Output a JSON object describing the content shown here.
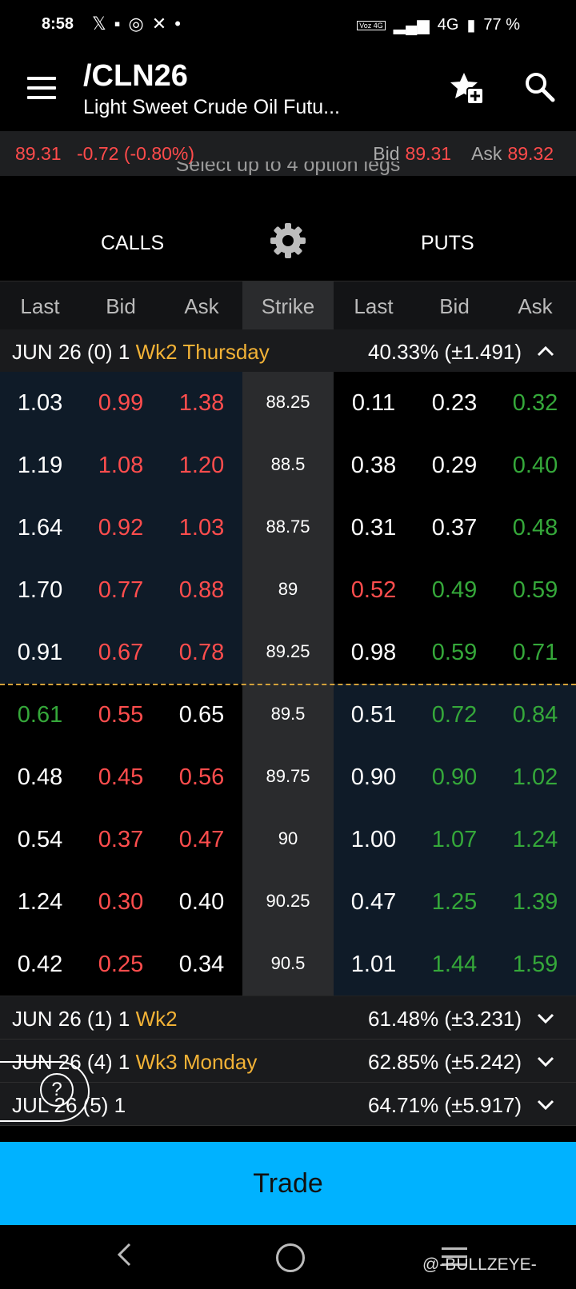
{
  "status_bar": {
    "time": "8:58",
    "left_icons": [
      "x-icon",
      "video-icon",
      "meta-icon",
      "crossed-icon",
      "dot-icon"
    ],
    "voz_label": "Voz 4G",
    "network": "4G",
    "battery": "77 %"
  },
  "header": {
    "symbol": "/CLN26",
    "description": "Light Sweet Crude Oil Futu..."
  },
  "quote": {
    "last": "89.31",
    "change": "-0.72 (-0.80%)",
    "bid_label": "Bid",
    "bid": "89.31",
    "ask_label": "Ask",
    "ask": "89.32"
  },
  "hint": "Select up to 4 option legs",
  "tabs": {
    "calls": "CALLS",
    "puts": "PUTS"
  },
  "columns": [
    "Last",
    "Bid",
    "Ask",
    "Strike",
    "Last",
    "Bid",
    "Ask"
  ],
  "groups": [
    {
      "label": "JUN 26 (0) 1",
      "week": "Wk2 Thursday",
      "iv": "40.33% (±1.491)",
      "expanded": true
    },
    {
      "label": "JUN 26 (1) 1",
      "week": "Wk2",
      "iv": "61.48% (±3.231)",
      "expanded": false
    },
    {
      "label": "JUN 26 (4) 1",
      "week": "Wk3 Monday",
      "iv": "62.85% (±5.242)",
      "expanded": false
    },
    {
      "label": "JUL 26 (5) 1",
      "week": "",
      "iv": "64.71% (±5.917)",
      "expanded": false
    }
  ],
  "rows": [
    {
      "call": [
        "1.03",
        "0.99",
        "1.38"
      ],
      "strike": "88.25",
      "put": [
        "0.11",
        "0.23",
        "0.32"
      ]
    },
    {
      "call": [
        "1.19",
        "1.08",
        "1.20"
      ],
      "strike": "88.5",
      "put": [
        "0.38",
        "0.29",
        "0.40"
      ]
    },
    {
      "call": [
        "1.64",
        "0.92",
        "1.03"
      ],
      "strike": "88.75",
      "put": [
        "0.31",
        "0.37",
        "0.48"
      ]
    },
    {
      "call": [
        "1.70",
        "0.77",
        "0.88"
      ],
      "strike": "89",
      "put": [
        "0.52",
        "0.49",
        "0.59"
      ]
    },
    {
      "call": [
        "0.91",
        "0.67",
        "0.78"
      ],
      "strike": "89.25",
      "put": [
        "0.98",
        "0.59",
        "0.71"
      ]
    },
    {
      "call": [
        "0.61",
        "0.55",
        "0.65"
      ],
      "strike": "89.5",
      "put": [
        "0.51",
        "0.72",
        "0.84"
      ]
    },
    {
      "call": [
        "0.48",
        "0.45",
        "0.56"
      ],
      "strike": "89.75",
      "put": [
        "0.90",
        "0.90",
        "1.02"
      ]
    },
    {
      "call": [
        "0.54",
        "0.37",
        "0.47"
      ],
      "strike": "90",
      "put": [
        "1.00",
        "1.07",
        "1.24"
      ]
    },
    {
      "call": [
        "1.24",
        "0.30",
        "0.40"
      ],
      "strike": "90.25",
      "put": [
        "0.47",
        "1.25",
        "1.39"
      ]
    },
    {
      "call": [
        "0.42",
        "0.25",
        "0.34"
      ],
      "strike": "90.5",
      "put": [
        "1.01",
        "1.44",
        "1.59"
      ]
    }
  ],
  "help_label": "?",
  "trade_button": "Trade",
  "watermark": "@-BULLZEYE-",
  "colors": {
    "red": "#ff4d4d",
    "green": "#35a83a",
    "accent": "#00b2ff",
    "week": "#f2b236"
  }
}
